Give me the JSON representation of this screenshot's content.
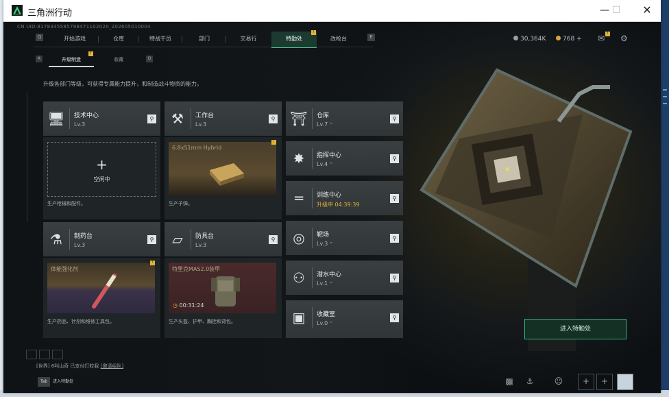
{
  "window": {
    "title": "三角洲行动"
  },
  "header": {
    "uid": "CN UID:8178345585798471102020_202605010004",
    "tabs": [
      {
        "label": "开始游戏",
        "active": false
      },
      {
        "label": "仓库",
        "active": false
      },
      {
        "label": "特战干员",
        "active": false
      },
      {
        "label": "部门",
        "active": false
      },
      {
        "label": "交易行",
        "active": false
      },
      {
        "label": "特勤处",
        "active": true,
        "badge": "!"
      },
      {
        "label": "改枪台",
        "active": false
      }
    ],
    "key_left": "Q",
    "key_right": "E",
    "currency1": "30,364K",
    "currency2": "768",
    "currency2_plus": "+",
    "mail_badge": "!"
  },
  "subtabs": {
    "key_left": "A",
    "key_right": "D",
    "items": [
      {
        "label": "升级制造",
        "active": true,
        "badge": "!"
      },
      {
        "label": "收藏",
        "active": false
      }
    ]
  },
  "description": "升级各部门等级，可获得专属能力提升，和制造战斗物资的能力。",
  "cards": [
    {
      "name": "技术中心",
      "level": "Lv.3",
      "icon": "computer-icon",
      "slot": "empty",
      "slot_label": "空闲中",
      "footer": "生产枪械和配件。"
    },
    {
      "name": "工作台",
      "level": "Lv.3",
      "icon": "tools-icon",
      "slot": "product",
      "product_name": "6.8x51mm Hybrid",
      "footer": "生产子弹。"
    },
    {
      "name": "制药台",
      "level": "Lv.3",
      "icon": "medicine-icon",
      "slot": "product",
      "product_name": "体能强化剂",
      "footer": "生产药品、针剂和维修工具包。"
    },
    {
      "name": "防具台",
      "level": "Lv.3",
      "icon": "armor-icon",
      "slot": "product",
      "product_name": "特里克MAS2.0装甲",
      "timer": "00:31:24",
      "footer": "生产头盔、护甲、胸挂和背包。"
    }
  ],
  "facilities": [
    {
      "name": "仓库",
      "level": "Lv.7",
      "upgradable": true,
      "icon": "storage-icon"
    },
    {
      "name": "指挥中心",
      "level": "Lv.4",
      "upgradable": true,
      "icon": "command-icon"
    },
    {
      "name": "训练中心",
      "level": "升级中 04:39:39",
      "upgradable": false,
      "icon": "dumbbell-icon"
    },
    {
      "name": "靶场",
      "level": "Lv.3",
      "upgradable": true,
      "icon": "target-icon"
    },
    {
      "name": "潜水中心",
      "level": "Lv.1",
      "upgradable": true,
      "icon": "diving-icon"
    },
    {
      "name": "收藏室",
      "level": "Lv.0",
      "upgradable": true,
      "icon": "collection-icon"
    }
  ],
  "enter_button": "进入特勤处",
  "chat": {
    "channel": "[世界]",
    "user": "6叫山奇",
    "message": "已支付打粒我",
    "link": "[邀请组队]"
  },
  "tab_hint": {
    "key": "Tab",
    "label": "进入特勤处"
  },
  "colors": {
    "accent_green": "#46c486",
    "badge_yellow": "#e2b434"
  }
}
